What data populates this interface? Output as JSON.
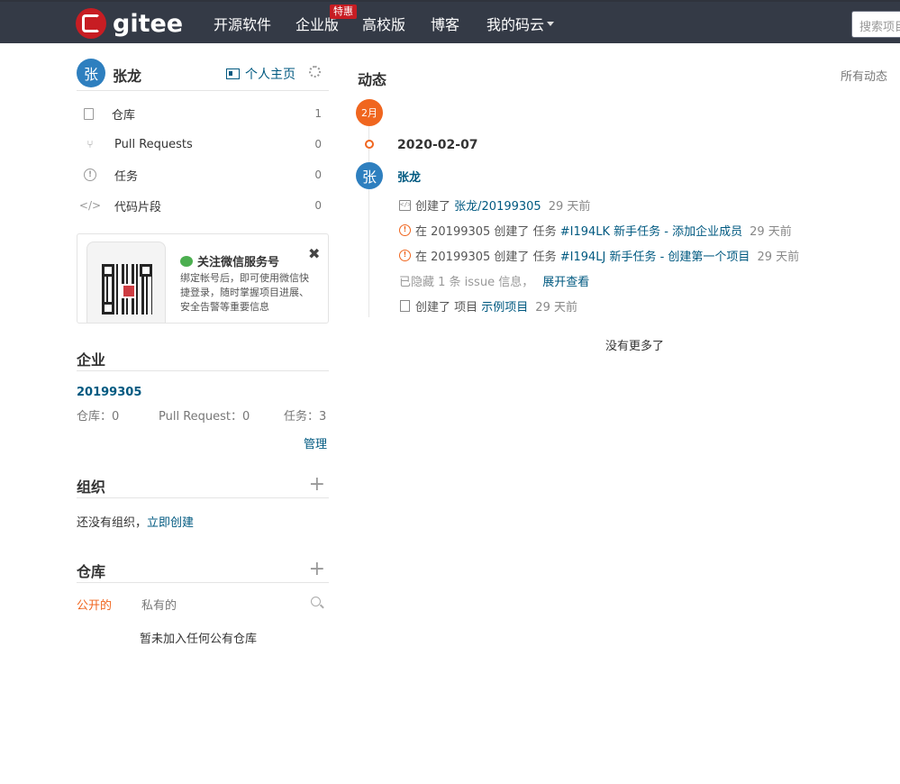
{
  "header": {
    "logo_text": "gitee",
    "nav": [
      "开源软件",
      "企业版",
      "高校版",
      "博客",
      "我的码云"
    ],
    "hot_badge": "特惠",
    "search_placeholder": "搜索项目"
  },
  "user": {
    "avatar_char": "张",
    "name": "张龙",
    "homepage_label": "个人主页"
  },
  "sidebar_menu": [
    {
      "label": "仓库",
      "count": "1",
      "icon": "repo-icon"
    },
    {
      "label": "Pull Requests",
      "count": "0",
      "icon": "pull-request-icon"
    },
    {
      "label": "任务",
      "count": "0",
      "icon": "issue-icon"
    },
    {
      "label": "代码片段",
      "count": "0",
      "icon": "code-snippet-icon"
    }
  ],
  "wechat": {
    "title": "关注微信服务号",
    "desc": "绑定帐号后，即可使用微信快捷登录，随时掌握项目进展、安全告警等重要信息",
    "close": "✖"
  },
  "enterprise": {
    "title": "企业",
    "name": "20199305",
    "repos": "仓库：0",
    "prs": "Pull Request：0",
    "tasks": "任务：3",
    "manage": "管理"
  },
  "organization": {
    "title": "组织",
    "empty_text": "还没有组织，",
    "create_link": "立即创建"
  },
  "repositories": {
    "title": "仓库",
    "tab_public": "公开的",
    "tab_private": "私有的",
    "empty_text": "暂未加入任何公有仓库"
  },
  "feed": {
    "title": "动态",
    "filter": "所有动态",
    "month": "2月",
    "date": "2020-02-07",
    "user": "张龙",
    "events": [
      {
        "type": "code",
        "prefix": "创建了",
        "link": "张龙/20199305",
        "time": "29 天前"
      },
      {
        "type": "issue",
        "prefix": "在 20199305 创建了 任务",
        "link": "#I194LK 新手任务 - 添加企业成员",
        "time": "29 天前"
      },
      {
        "type": "issue",
        "prefix": "在 20199305 创建了 任务",
        "link": "#I194LJ 新手任务 - 创建第一个项目",
        "time": "29 天前"
      }
    ],
    "hidden_text": "已隐藏 1 条 issue 信息，",
    "expand_link": "展开查看",
    "project_event": {
      "prefix": "创建了 项目",
      "link": "示例项目",
      "time": "29 天前"
    },
    "no_more": "没有更多了"
  }
}
